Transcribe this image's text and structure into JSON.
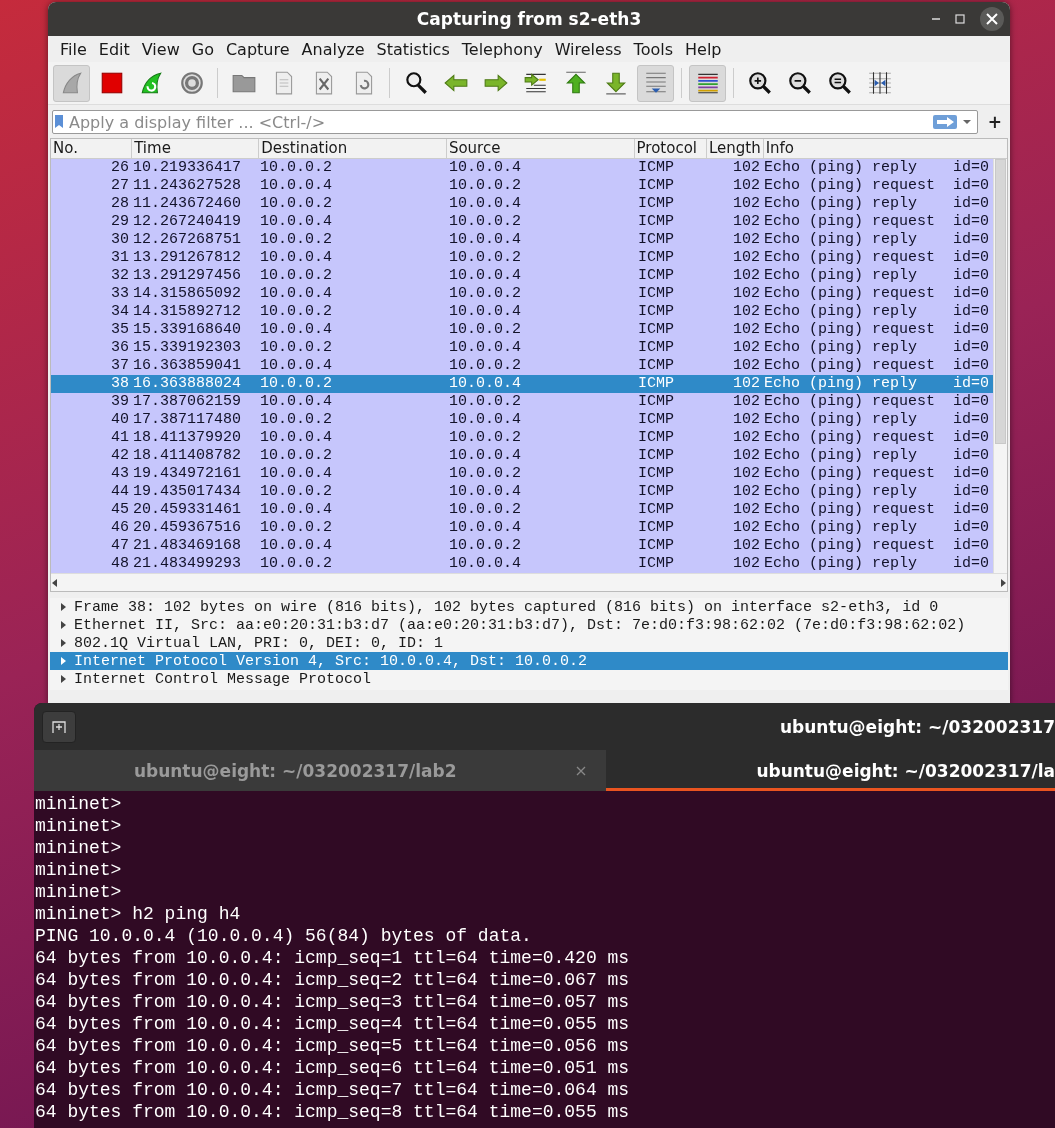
{
  "wireshark": {
    "title": "Capturing from s2-eth3",
    "menu": [
      "File",
      "Edit",
      "View",
      "Go",
      "Capture",
      "Analyze",
      "Statistics",
      "Telephony",
      "Wireless",
      "Tools",
      "Help"
    ],
    "toolbar": [
      {
        "kind": "fin",
        "pressed": true
      },
      {
        "kind": "stop",
        "pressed": false
      },
      {
        "kind": "restart",
        "pressed": false
      },
      {
        "kind": "options",
        "pressed": false
      },
      {
        "kind": "separator"
      },
      {
        "kind": "open",
        "pressed": false
      },
      {
        "kind": "save",
        "pressed": false
      },
      {
        "kind": "closefile",
        "pressed": false
      },
      {
        "kind": "reload",
        "pressed": false
      },
      {
        "kind": "separator"
      },
      {
        "kind": "find",
        "pressed": false
      },
      {
        "kind": "back",
        "pressed": false
      },
      {
        "kind": "forward",
        "pressed": false
      },
      {
        "kind": "goto",
        "pressed": false
      },
      {
        "kind": "first",
        "pressed": false
      },
      {
        "kind": "last",
        "pressed": false
      },
      {
        "kind": "autoscroll",
        "pressed": true
      },
      {
        "kind": "separator"
      },
      {
        "kind": "colorize",
        "pressed": true
      },
      {
        "kind": "separator"
      },
      {
        "kind": "zoomin",
        "pressed": false
      },
      {
        "kind": "zoomout",
        "pressed": false
      },
      {
        "kind": "zoomreset",
        "pressed": false
      },
      {
        "kind": "resize",
        "pressed": false
      }
    ],
    "filter": {
      "placeholder": "Apply a display filter ... <Ctrl-/>",
      "add_button": "+"
    },
    "columns": [
      "No.",
      "Time",
      "Destination",
      "Source",
      "Protocol",
      "Length",
      "Info"
    ],
    "rows": [
      {
        "no": "26",
        "time": "10.219336417",
        "destination": "10.0.0.2",
        "source": "10.0.0.4",
        "protocol": "ICMP",
        "length": "102",
        "info": "Echo (ping) reply    id=0",
        "selected": false
      },
      {
        "no": "27",
        "time": "11.243627528",
        "destination": "10.0.0.4",
        "source": "10.0.0.2",
        "protocol": "ICMP",
        "length": "102",
        "info": "Echo (ping) request  id=0",
        "selected": false
      },
      {
        "no": "28",
        "time": "11.243672460",
        "destination": "10.0.0.2",
        "source": "10.0.0.4",
        "protocol": "ICMP",
        "length": "102",
        "info": "Echo (ping) reply    id=0",
        "selected": false
      },
      {
        "no": "29",
        "time": "12.267240419",
        "destination": "10.0.0.4",
        "source": "10.0.0.2",
        "protocol": "ICMP",
        "length": "102",
        "info": "Echo (ping) request  id=0",
        "selected": false
      },
      {
        "no": "30",
        "time": "12.267268751",
        "destination": "10.0.0.2",
        "source": "10.0.0.4",
        "protocol": "ICMP",
        "length": "102",
        "info": "Echo (ping) reply    id=0",
        "selected": false
      },
      {
        "no": "31",
        "time": "13.291267812",
        "destination": "10.0.0.4",
        "source": "10.0.0.2",
        "protocol": "ICMP",
        "length": "102",
        "info": "Echo (ping) request  id=0",
        "selected": false
      },
      {
        "no": "32",
        "time": "13.291297456",
        "destination": "10.0.0.2",
        "source": "10.0.0.4",
        "protocol": "ICMP",
        "length": "102",
        "info": "Echo (ping) reply    id=0",
        "selected": false
      },
      {
        "no": "33",
        "time": "14.315865092",
        "destination": "10.0.0.4",
        "source": "10.0.0.2",
        "protocol": "ICMP",
        "length": "102",
        "info": "Echo (ping) request  id=0",
        "selected": false
      },
      {
        "no": "34",
        "time": "14.315892712",
        "destination": "10.0.0.2",
        "source": "10.0.0.4",
        "protocol": "ICMP",
        "length": "102",
        "info": "Echo (ping) reply    id=0",
        "selected": false
      },
      {
        "no": "35",
        "time": "15.339168640",
        "destination": "10.0.0.4",
        "source": "10.0.0.2",
        "protocol": "ICMP",
        "length": "102",
        "info": "Echo (ping) request  id=0",
        "selected": false
      },
      {
        "no": "36",
        "time": "15.339192303",
        "destination": "10.0.0.2",
        "source": "10.0.0.4",
        "protocol": "ICMP",
        "length": "102",
        "info": "Echo (ping) reply    id=0",
        "selected": false
      },
      {
        "no": "37",
        "time": "16.363859041",
        "destination": "10.0.0.4",
        "source": "10.0.0.2",
        "protocol": "ICMP",
        "length": "102",
        "info": "Echo (ping) request  id=0",
        "selected": false
      },
      {
        "no": "38",
        "time": "16.363888024",
        "destination": "10.0.0.2",
        "source": "10.0.0.4",
        "protocol": "ICMP",
        "length": "102",
        "info": "Echo (ping) reply    id=0",
        "selected": true
      },
      {
        "no": "39",
        "time": "17.387062159",
        "destination": "10.0.0.4",
        "source": "10.0.0.2",
        "protocol": "ICMP",
        "length": "102",
        "info": "Echo (ping) request  id=0",
        "selected": false
      },
      {
        "no": "40",
        "time": "17.387117480",
        "destination": "10.0.0.2",
        "source": "10.0.0.4",
        "protocol": "ICMP",
        "length": "102",
        "info": "Echo (ping) reply    id=0",
        "selected": false
      },
      {
        "no": "41",
        "time": "18.411379920",
        "destination": "10.0.0.4",
        "source": "10.0.0.2",
        "protocol": "ICMP",
        "length": "102",
        "info": "Echo (ping) request  id=0",
        "selected": false
      },
      {
        "no": "42",
        "time": "18.411408782",
        "destination": "10.0.0.2",
        "source": "10.0.0.4",
        "protocol": "ICMP",
        "length": "102",
        "info": "Echo (ping) reply    id=0",
        "selected": false
      },
      {
        "no": "43",
        "time": "19.434972161",
        "destination": "10.0.0.4",
        "source": "10.0.0.2",
        "protocol": "ICMP",
        "length": "102",
        "info": "Echo (ping) request  id=0",
        "selected": false
      },
      {
        "no": "44",
        "time": "19.435017434",
        "destination": "10.0.0.2",
        "source": "10.0.0.4",
        "protocol": "ICMP",
        "length": "102",
        "info": "Echo (ping) reply    id=0",
        "selected": false
      },
      {
        "no": "45",
        "time": "20.459331461",
        "destination": "10.0.0.4",
        "source": "10.0.0.2",
        "protocol": "ICMP",
        "length": "102",
        "info": "Echo (ping) request  id=0",
        "selected": false
      },
      {
        "no": "46",
        "time": "20.459367516",
        "destination": "10.0.0.2",
        "source": "10.0.0.4",
        "protocol": "ICMP",
        "length": "102",
        "info": "Echo (ping) reply    id=0",
        "selected": false
      },
      {
        "no": "47",
        "time": "21.483469168",
        "destination": "10.0.0.4",
        "source": "10.0.0.2",
        "protocol": "ICMP",
        "length": "102",
        "info": "Echo (ping) request  id=0",
        "selected": false
      },
      {
        "no": "48",
        "time": "21.483499293",
        "destination": "10.0.0.2",
        "source": "10.0.0.4",
        "protocol": "ICMP",
        "length": "102",
        "info": "Echo (ping) reply    id=0",
        "selected": false
      }
    ],
    "details": [
      {
        "label": "Frame 38: 102 bytes on wire (816 bits), 102 bytes captured (816 bits) on interface s2-eth3, id 0",
        "expanded": false,
        "selected": false
      },
      {
        "label": "Ethernet II, Src: aa:e0:20:31:b3:d7 (aa:e0:20:31:b3:d7), Dst: 7e:d0:f3:98:62:02 (7e:d0:f3:98:62:02)",
        "expanded": false,
        "selected": false
      },
      {
        "label": "802.1Q Virtual LAN, PRI: 0, DEI: 0, ID: 1",
        "expanded": false,
        "selected": false
      },
      {
        "label": "Internet Protocol Version 4, Src: 10.0.0.4, Dst: 10.0.0.2",
        "expanded": false,
        "selected": true
      },
      {
        "label": "Internet Control Message Protocol",
        "expanded": false,
        "selected": false
      }
    ]
  },
  "terminal": {
    "title": "ubuntu@eight: ~/032002317",
    "tabs": [
      {
        "label": "ubuntu@eight: ~/032002317/lab2",
        "selected": false
      },
      {
        "label": "ubuntu@eight: ~/032002317/la",
        "selected": true
      }
    ],
    "lines": [
      "mininet>",
      "mininet>",
      "mininet>",
      "mininet>",
      "mininet>",
      "mininet> h2 ping h4",
      "PING 10.0.0.4 (10.0.0.4) 56(84) bytes of data.",
      "64 bytes from 10.0.0.4: icmp_seq=1 ttl=64 time=0.420 ms",
      "64 bytes from 10.0.0.4: icmp_seq=2 ttl=64 time=0.067 ms",
      "64 bytes from 10.0.0.4: icmp_seq=3 ttl=64 time=0.057 ms",
      "64 bytes from 10.0.0.4: icmp_seq=4 ttl=64 time=0.055 ms",
      "64 bytes from 10.0.0.4: icmp_seq=5 ttl=64 time=0.056 ms",
      "64 bytes from 10.0.0.4: icmp_seq=6 ttl=64 time=0.051 ms",
      "64 bytes from 10.0.0.4: icmp_seq=7 ttl=64 time=0.064 ms",
      "64 bytes from 10.0.0.4: icmp_seq=8 ttl=64 time=0.055 ms"
    ]
  }
}
